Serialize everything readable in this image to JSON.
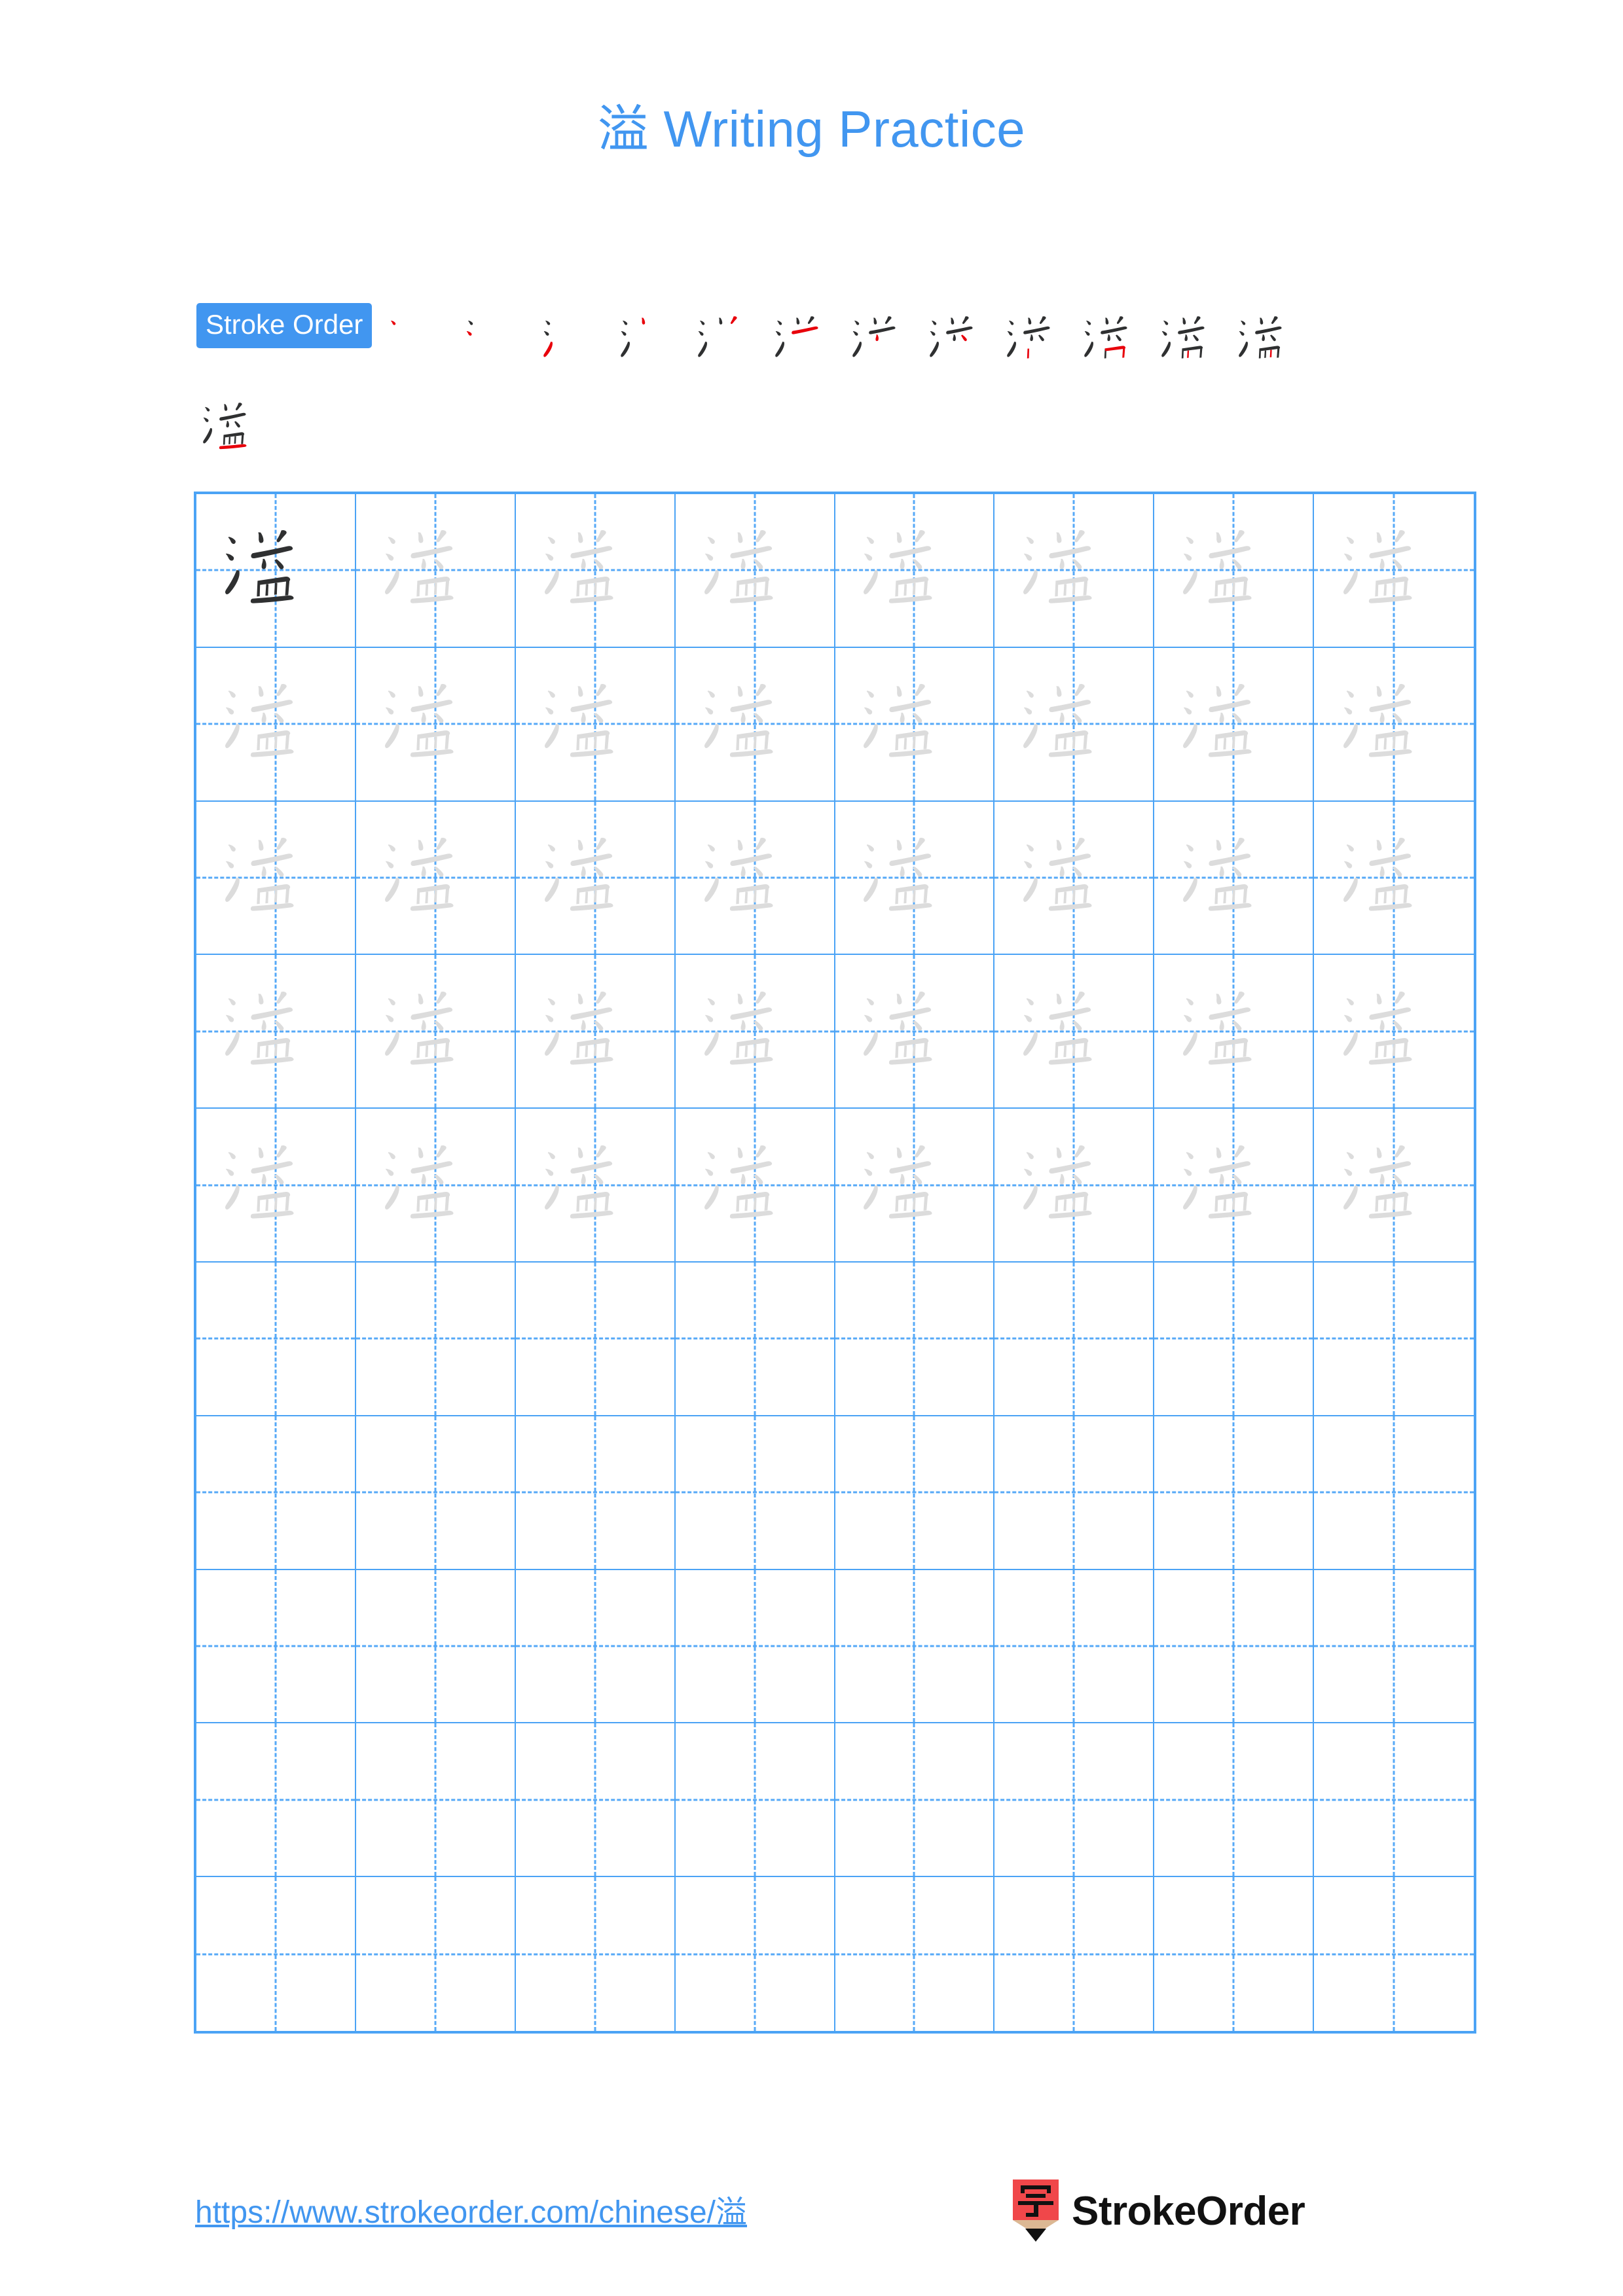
{
  "page": {
    "character": "溢",
    "title": "溢 Writing Practice",
    "title_suffix": " Writing Practice",
    "accent_color": "#4196f0",
    "grid_line_color": "#4ba3f5",
    "trace_color": "#dcdcdc",
    "model_color": "#2f3031",
    "new_stroke_color": "#e8000b"
  },
  "stroke_order": {
    "label": "Stroke Order",
    "total_strokes": 13,
    "steps_line1": 12,
    "steps_line2": 1
  },
  "grid": {
    "columns": 8,
    "rows": 10,
    "model_cells": 1,
    "traced_rows": 5,
    "empty_rows": 5
  },
  "footer": {
    "url": "https://www.strokeorder.com/chinese/溢",
    "brand": "StrokeOrder",
    "logo_char": "字",
    "logo_body_color": "#f0474a",
    "logo_wood_color": "#dcb894",
    "logo_tip_color": "#111111"
  }
}
